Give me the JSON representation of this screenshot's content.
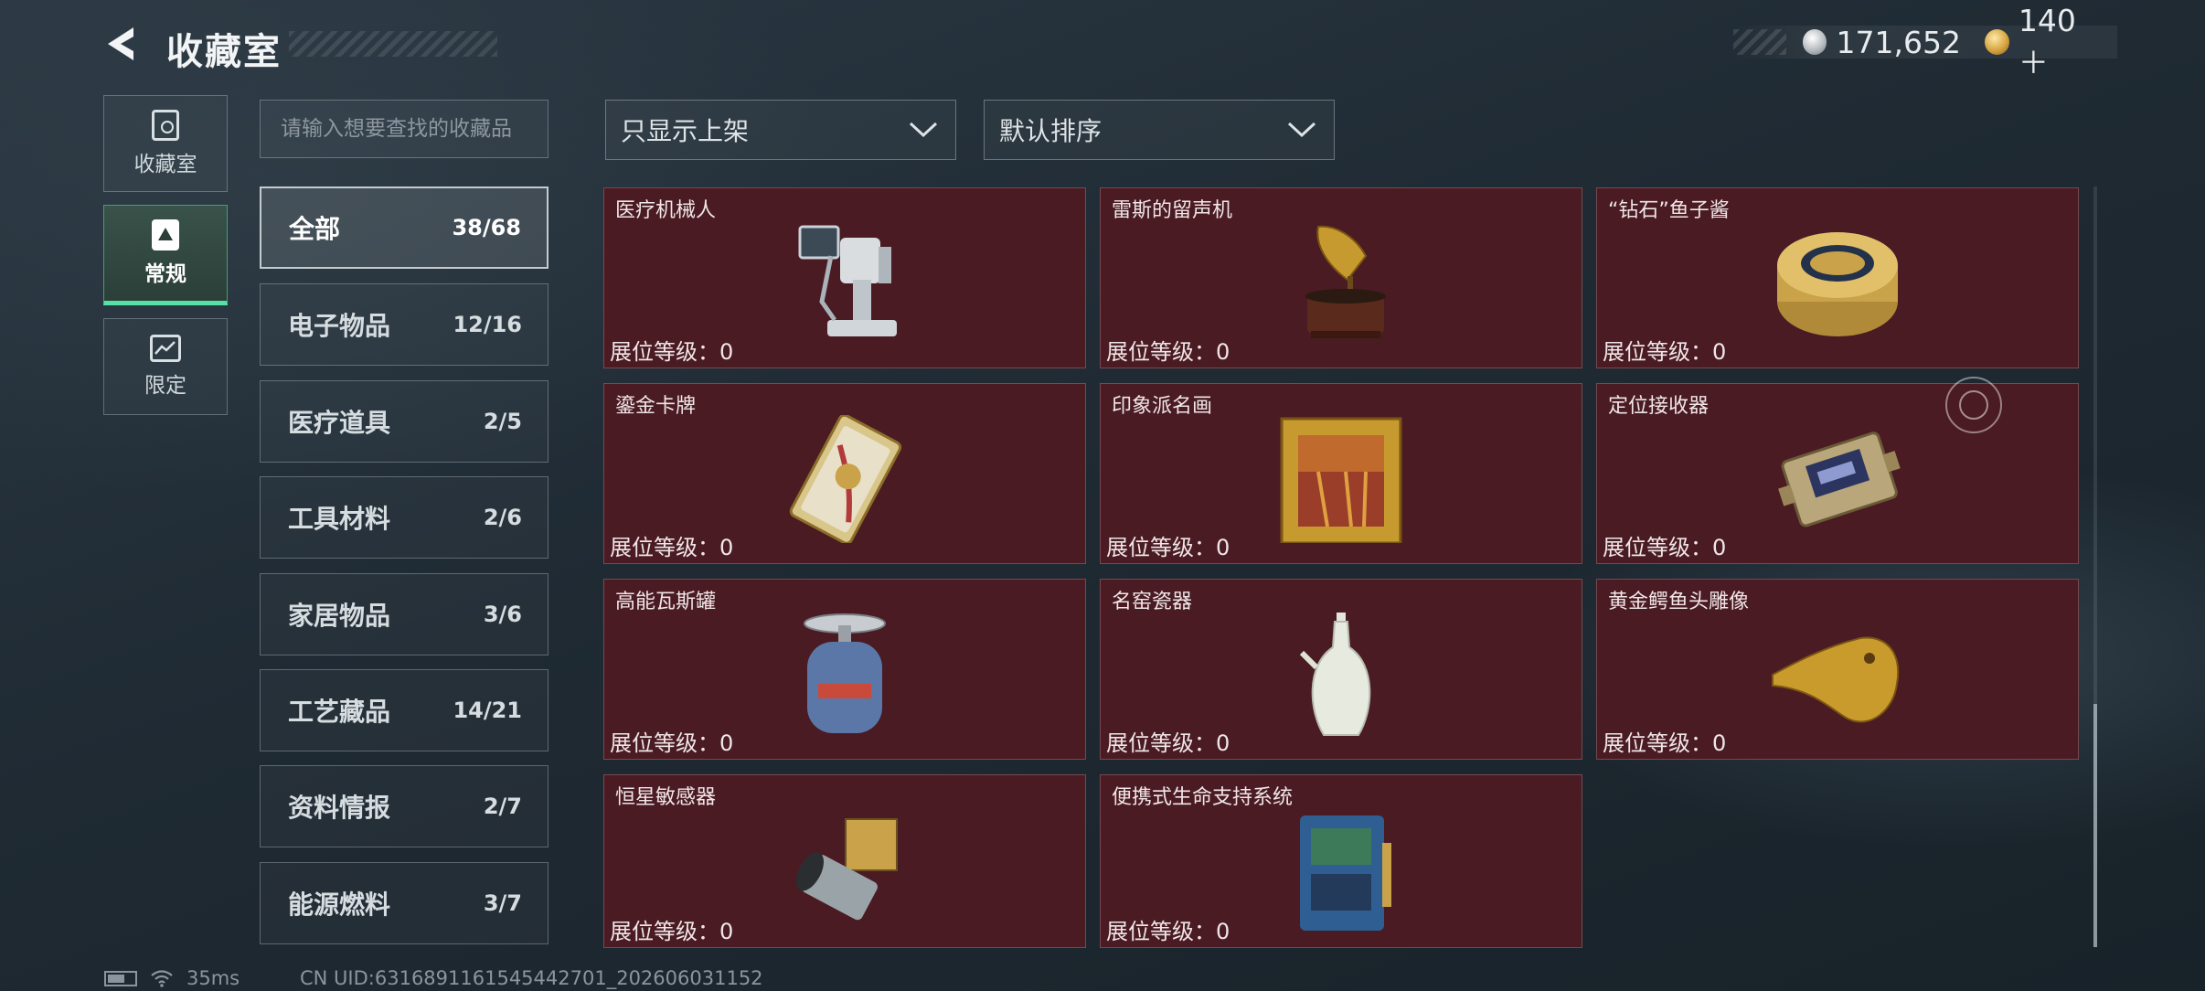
{
  "header": {
    "title": "收藏室",
    "currency_silver": "171,652",
    "currency_gold": "140＋"
  },
  "nav": {
    "tabs": [
      {
        "label": "收藏室",
        "icon": "collection-room-icon"
      },
      {
        "label": "常规",
        "icon": "regular-icon",
        "active": true
      },
      {
        "label": "限定",
        "icon": "limited-icon"
      }
    ]
  },
  "search": {
    "placeholder": "请输入想要查找的收藏品"
  },
  "categories": [
    {
      "name": "全部",
      "count": "38/68",
      "active": true
    },
    {
      "name": "电子物品",
      "count": "12/16"
    },
    {
      "name": "医疗道具",
      "count": "2/5"
    },
    {
      "name": "工具材料",
      "count": "2/6"
    },
    {
      "name": "家居物品",
      "count": "3/6"
    },
    {
      "name": "工艺藏品",
      "count": "14/21"
    },
    {
      "name": "资料情报",
      "count": "2/7"
    },
    {
      "name": "能源燃料",
      "count": "3/7"
    }
  ],
  "filters": {
    "shelf_filter": "只显示上架",
    "sort": "默认排序"
  },
  "items": [
    {
      "name": "医疗机械人",
      "level": "展位等级：0"
    },
    {
      "name": "雷斯的留声机",
      "level": "展位等级：0"
    },
    {
      "name": "“钻石”鱼子酱",
      "level": "展位等级：0"
    },
    {
      "name": "鎏金卡牌",
      "level": "展位等级：0"
    },
    {
      "name": "印象派名画",
      "level": "展位等级：0"
    },
    {
      "name": "定位接收器",
      "level": "展位等级：0"
    },
    {
      "name": "高能瓦斯罐",
      "level": "展位等级：0"
    },
    {
      "name": "名窑瓷器",
      "level": "展位等级：0"
    },
    {
      "name": "黄金鳄鱼头雕像",
      "level": "展位等级：0"
    },
    {
      "name": "恒星敏感器",
      "level": "展位等级：0"
    },
    {
      "name": "便携式生命支持系统",
      "level": "展位等级：0"
    }
  ],
  "footer": {
    "ping": "35ms",
    "uid": "CN UID:6316891161545442701_202606031152"
  }
}
